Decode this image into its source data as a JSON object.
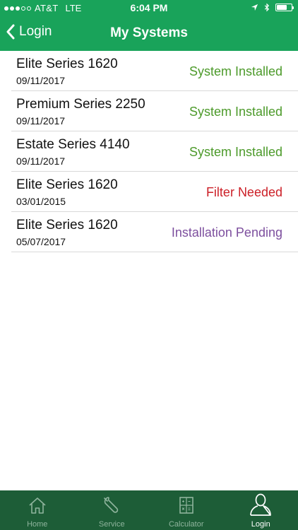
{
  "status_bar": {
    "carrier": "AT&T",
    "network": "LTE",
    "time": "6:04 PM"
  },
  "header": {
    "back_label": "Login",
    "title": "My Systems"
  },
  "colors": {
    "header_green": "#19a35a",
    "tab_bar_green": "#1d5d37",
    "status_installed": "#4c9a2a",
    "status_filter": "#cc1f27",
    "status_pending": "#7d4f9e"
  },
  "systems": [
    {
      "name": "Elite Series 1620",
      "date": "09/11/2017",
      "status": "System Installed",
      "status_color": "#4c9a2a"
    },
    {
      "name": "Premium Series 2250",
      "date": "09/11/2017",
      "status": "System Installed",
      "status_color": "#4c9a2a"
    },
    {
      "name": "Estate Series 4140",
      "date": "09/11/2017",
      "status": "System Installed",
      "status_color": "#4c9a2a"
    },
    {
      "name": "Elite Series 1620",
      "date": "03/01/2015",
      "status": "Filter Needed",
      "status_color": "#cc1f27"
    },
    {
      "name": "Elite Series 1620",
      "date": "05/07/2017",
      "status": "Installation Pending",
      "status_color": "#7d4f9e"
    }
  ],
  "tabs": [
    {
      "label": "Home",
      "icon": "home-icon",
      "active": false
    },
    {
      "label": "Service",
      "icon": "wrench-icon",
      "active": false
    },
    {
      "label": "Calculator",
      "icon": "calculator-icon",
      "active": false
    },
    {
      "label": "Login",
      "icon": "user-icon",
      "active": true
    }
  ]
}
